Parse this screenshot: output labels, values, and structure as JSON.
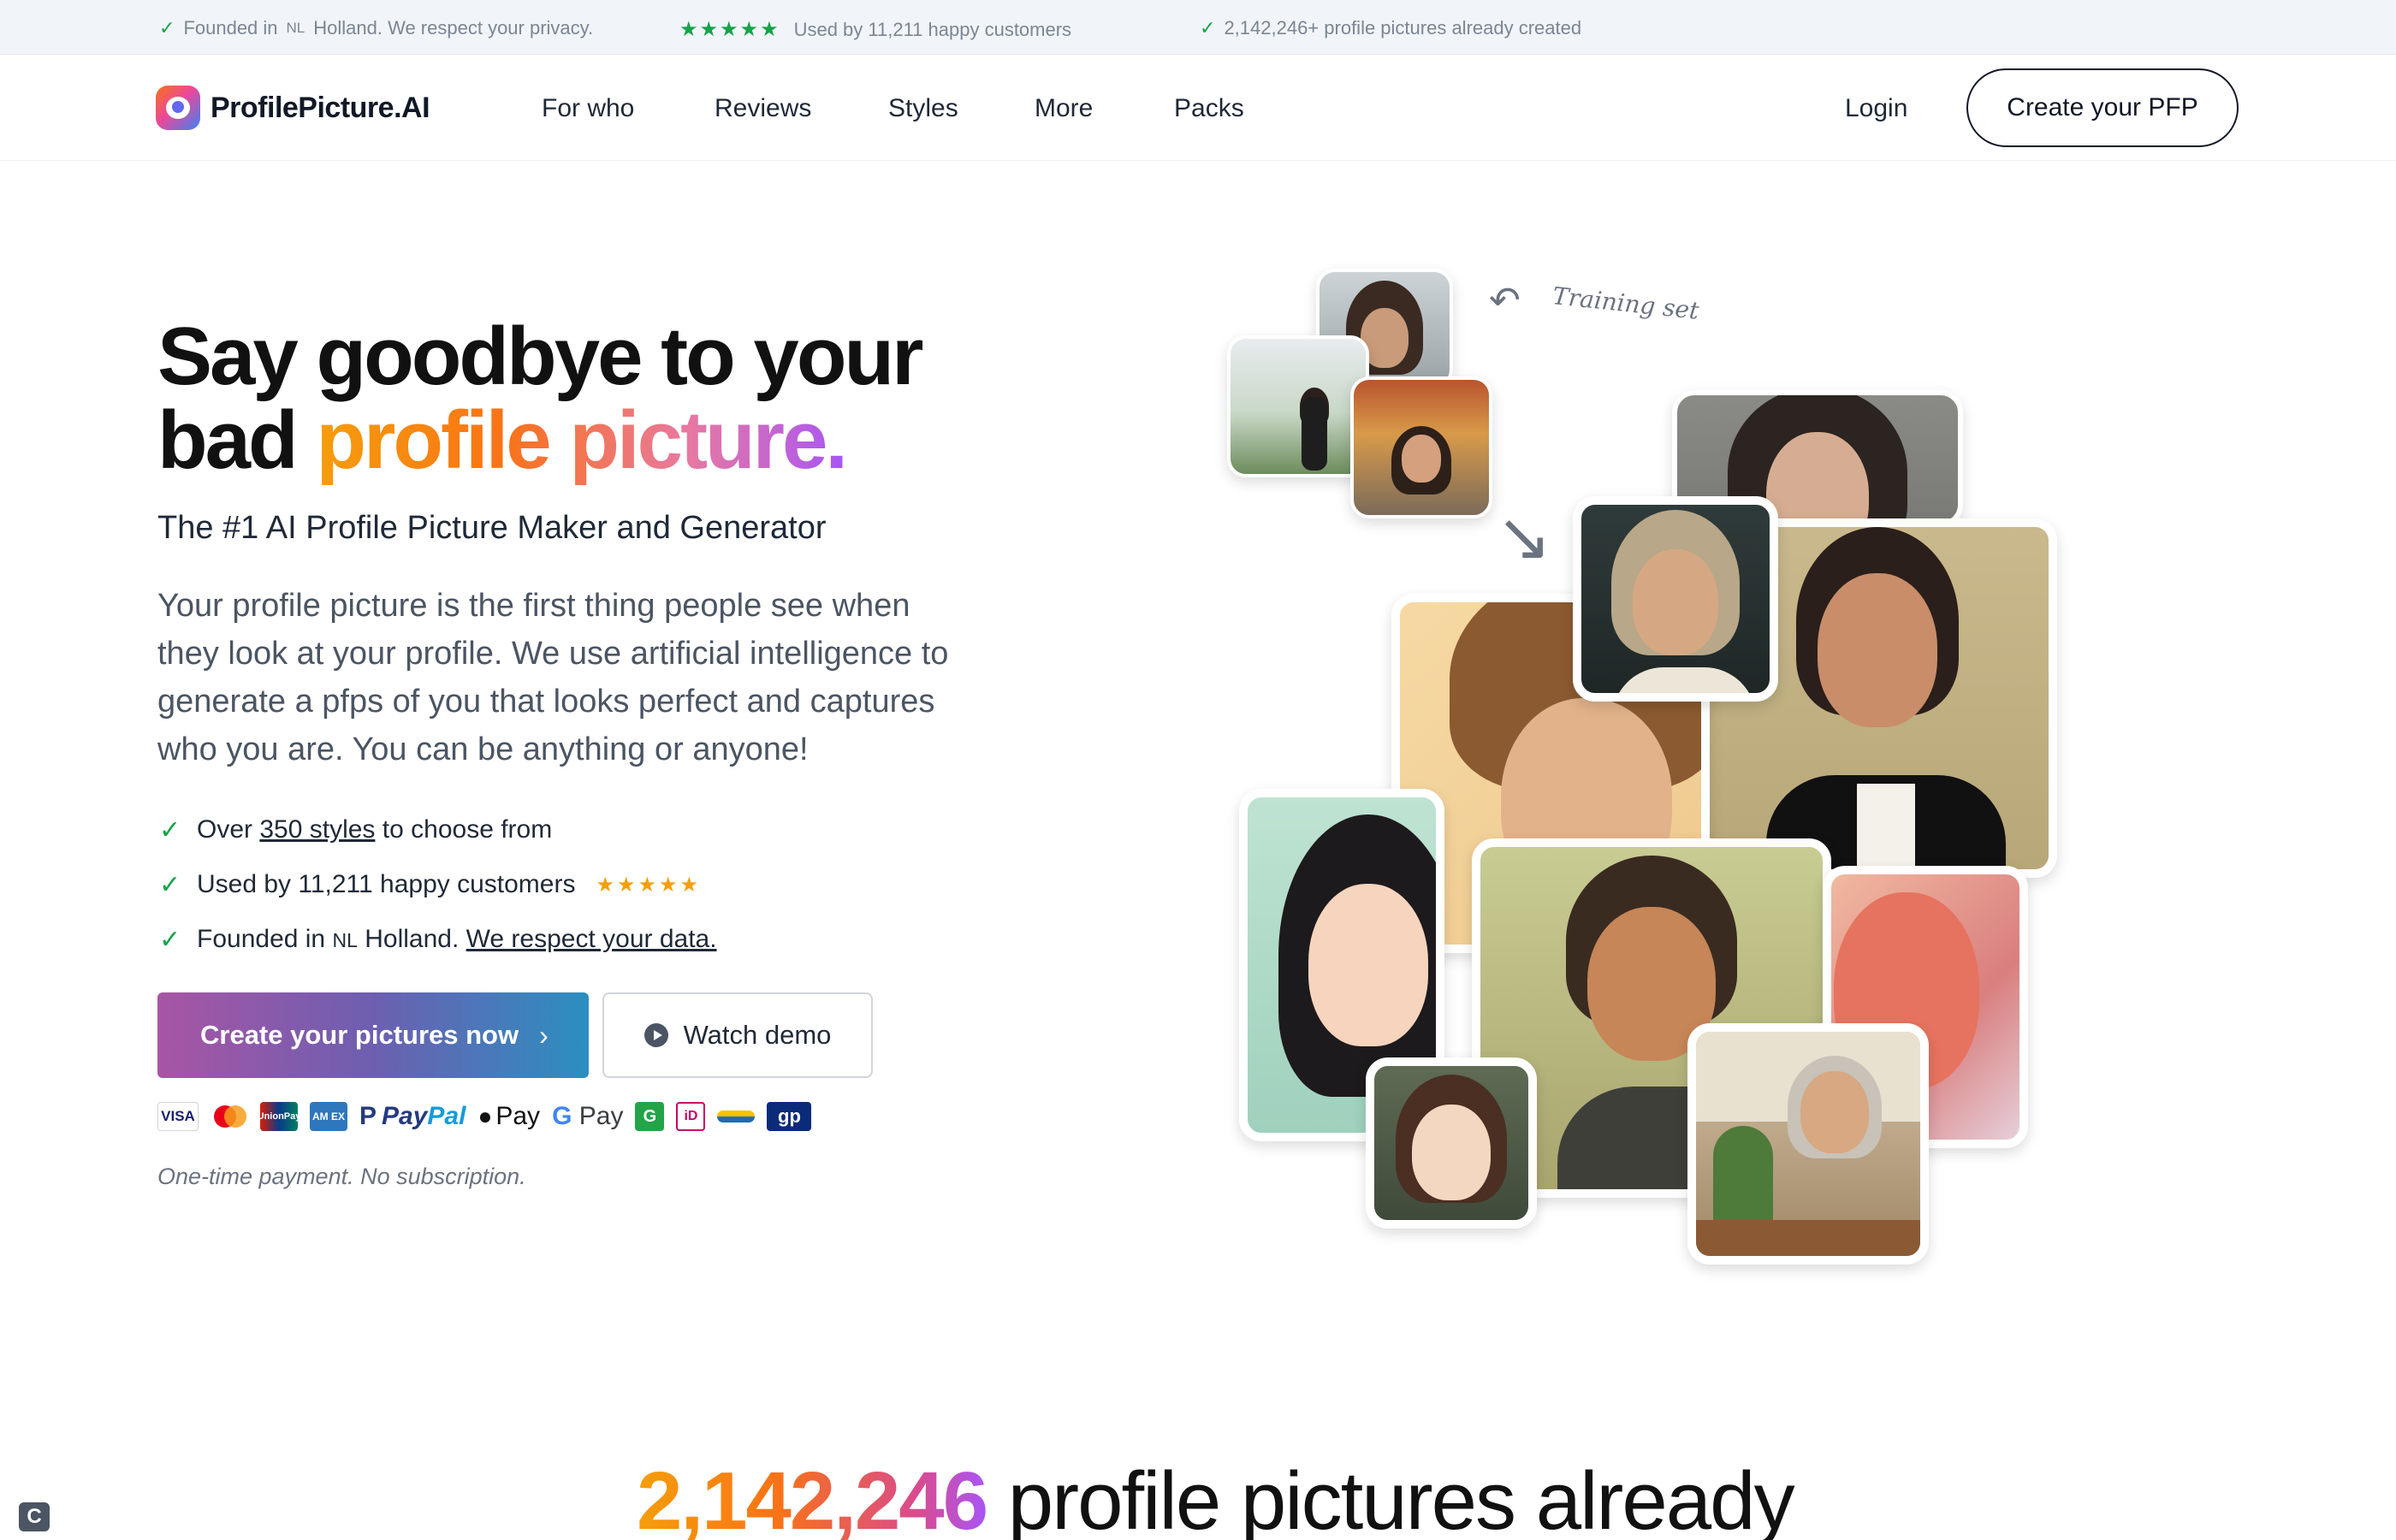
{
  "topbar": {
    "founded_prefix": "Founded in",
    "founded_country_code": "NL",
    "founded_suffix": "Holland. We respect your privacy.",
    "stars": "★★★★★",
    "customers": "Used by 11,211 happy customers",
    "created": "2,142,246+ profile pictures already created"
  },
  "nav": {
    "brand": "ProfilePicture.AI",
    "links": [
      "For who",
      "Reviews",
      "Styles",
      "More",
      "Packs"
    ],
    "login": "Login",
    "cta": "Create your PFP"
  },
  "hero": {
    "headline_line1": "Say goodbye to your",
    "headline_line2_plain": "bad",
    "headline_line2_highlight": "profile picture.",
    "subtitle": "The #1 AI Profile Picture Maker and Generator",
    "description": "Your profile picture is the first thing people see when they look at your profile. We use artificial intelligence to generate a pfps of you that looks perfect and captures who you are. You can be anything or anyone!",
    "bullets": {
      "b1_pre": "Over",
      "b1_link": "350 styles",
      "b1_post": "to choose from",
      "b2": "Used by 11,211 happy customers",
      "b2_stars": "★★★★★",
      "b3_pre": "Founded in",
      "b3_code": "NL",
      "b3_mid": "Holland.",
      "b3_link": "We respect your data."
    },
    "primary_button": "Create your pictures now",
    "primary_chevron": "›",
    "secondary_button": "Watch demo",
    "payments": {
      "visa": "VISA",
      "unionpay": "UnionPay",
      "amex": "AM EX",
      "paypal_a": "Pay",
      "paypal_b": "Pal",
      "apple_pay": "Pay",
      "google_pay_g": "G",
      "google_pay": "Pay",
      "g_badge": "G",
      "ideal": "iD",
      "giropay": "gp"
    },
    "note": "One-time payment. No subscription."
  },
  "collage": {
    "training_label": "Training set",
    "colors": {
      "green_check": "#16a34a",
      "star_gold": "#f59e0b"
    }
  },
  "stats": {
    "number": "2,142,246",
    "text": "profile pictures already"
  },
  "corner_badge": "C"
}
